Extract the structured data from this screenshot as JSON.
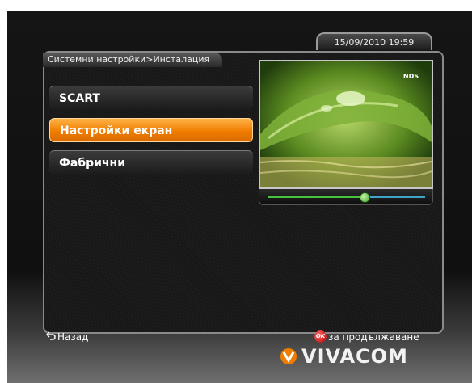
{
  "header": {
    "datetime": "15/09/2010 19:59",
    "breadcrumb": "Системни настройки>Инсталация"
  },
  "menu": {
    "items": [
      {
        "label": "SCART",
        "selected": false
      },
      {
        "label": "Настройки екран",
        "selected": true
      },
      {
        "label": "Фабрични",
        "selected": false
      }
    ]
  },
  "preview": {
    "watermark": "NDS",
    "slider_fraction": 0.58,
    "slider_left_color": "#48c23a",
    "slider_right_color": "#3fa5c8"
  },
  "footer": {
    "back_label": "Назад",
    "back_icon": "return-arrow-icon",
    "continue_button": "OK",
    "continue_label": "за продължаване"
  },
  "brand": {
    "name": "VIVACOM",
    "accent": "#f07d00"
  }
}
